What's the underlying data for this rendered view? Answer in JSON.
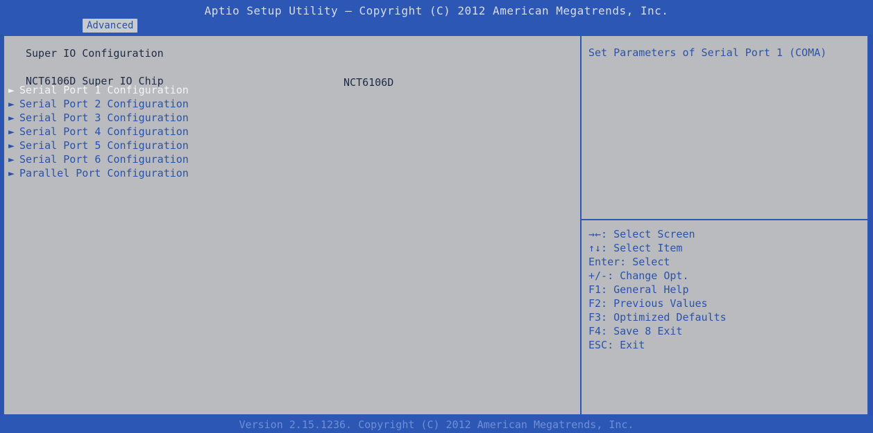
{
  "header": {
    "title": "Aptio Setup Utility – Copyright (C) 2012 American Megatrends, Inc.",
    "tab_label": "Advanced"
  },
  "left": {
    "section_title": "Super IO Configuration",
    "chip_label": "NCT6106D Super IO Chip",
    "chip_value": "NCT6106D",
    "arrow_glyph": "►",
    "menu_items": [
      {
        "label": "Serial Port 1 Configuration",
        "selected": true
      },
      {
        "label": "Serial Port 2 Configuration",
        "selected": false
      },
      {
        "label": "Serial Port 3 Configuration",
        "selected": false
      },
      {
        "label": "Serial Port 4 Configuration",
        "selected": false
      },
      {
        "label": "Serial Port 5 Configuration",
        "selected": false
      },
      {
        "label": "Serial Port 6 Configuration",
        "selected": false
      },
      {
        "label": "Parallel Port Configuration",
        "selected": false
      }
    ]
  },
  "right": {
    "help_text": "Set Parameters of Serial Port 1 (COMA)",
    "keys": [
      "→←: Select Screen",
      "↑↓: Select Item",
      "Enter: Select",
      "+/-: Change Opt.",
      "F1: General Help",
      "F2: Previous Values",
      "F3: Optimized Defaults",
      "F4: Save 8 Exit",
      "ESC: Exit"
    ]
  },
  "footer": {
    "text": "Version 2.15.1236. Copyright (C) 2012 American Megatrends, Inc."
  },
  "colors": {
    "bios_blue": "#2d57b5",
    "panel_gray": "#b9bbbf",
    "selected_text": "#f3f4f6",
    "menu_text": "#2b52a9"
  }
}
